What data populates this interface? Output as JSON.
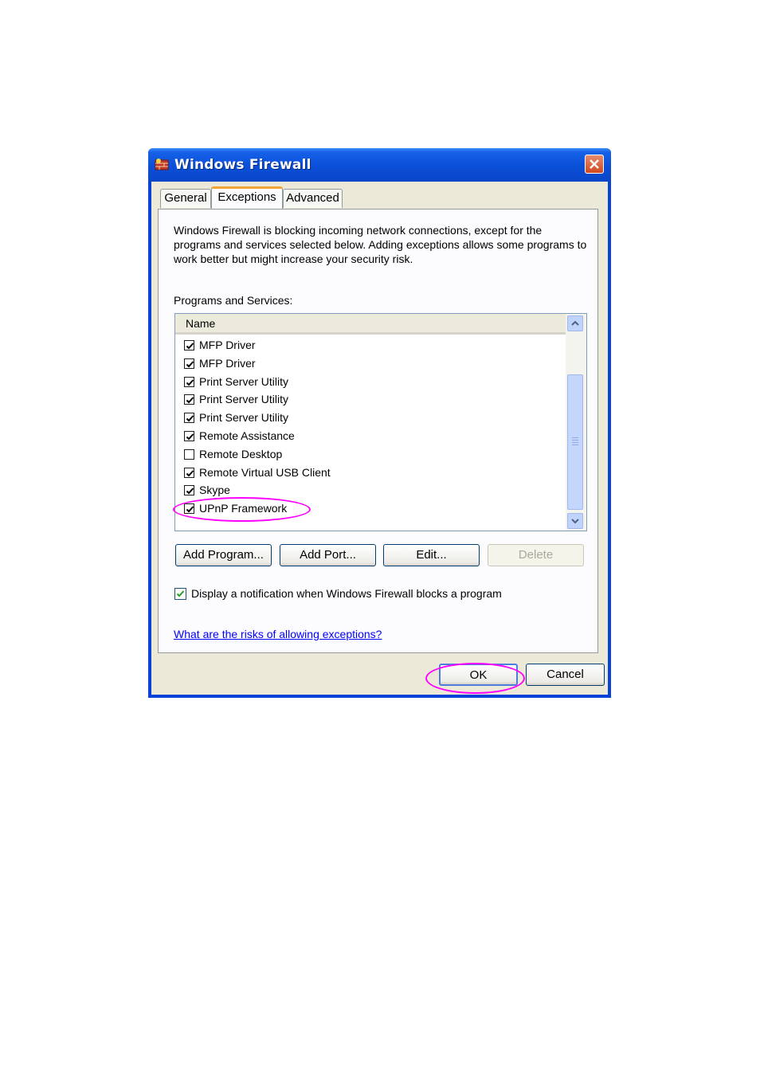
{
  "window": {
    "title": "Windows Firewall",
    "accent": "#0842d6"
  },
  "tabs": [
    {
      "label": "General",
      "active": false
    },
    {
      "label": "Exceptions",
      "active": true
    },
    {
      "label": "Advanced",
      "active": false
    }
  ],
  "exceptions": {
    "intro": "Windows Firewall is blocking incoming network connections, except for the programs and services selected below. Adding exceptions allows some programs to work better but might increase your security risk.",
    "section_label": "Programs and Services:",
    "column_header": "Name",
    "items": [
      {
        "label": "MFP Driver",
        "checked": true
      },
      {
        "label": "MFP Driver",
        "checked": true
      },
      {
        "label": "Print Server Utility",
        "checked": true
      },
      {
        "label": "Print Server Utility",
        "checked": true
      },
      {
        "label": "Print Server Utility",
        "checked": true
      },
      {
        "label": "Remote Assistance",
        "checked": true
      },
      {
        "label": "Remote Desktop",
        "checked": false
      },
      {
        "label": "Remote Virtual USB Client",
        "checked": true
      },
      {
        "label": "Skype",
        "checked": true
      },
      {
        "label": "UPnP Framework",
        "checked": true
      }
    ],
    "buttons": {
      "add_program": "Add Program...",
      "add_port": "Add Port...",
      "edit": "Edit...",
      "delete": "Delete"
    },
    "notify_label": "Display a notification when Windows Firewall blocks a program",
    "notify_checked": true,
    "help_link": "What are the risks of allowing exceptions?"
  },
  "footer": {
    "ok": "OK",
    "cancel": "Cancel"
  },
  "annotations": {
    "highlight_color": "#ff00ff"
  }
}
